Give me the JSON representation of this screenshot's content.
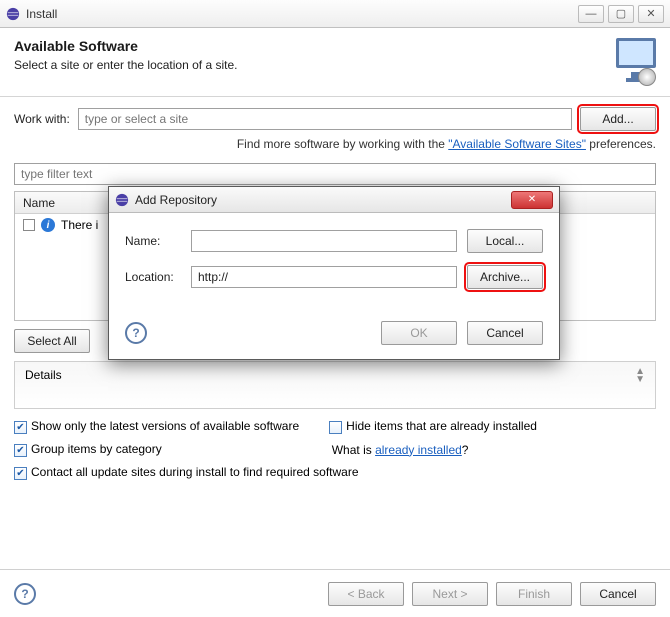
{
  "window": {
    "title": "Install"
  },
  "header": {
    "title": "Available Software",
    "subtitle": "Select a site or enter the location of a site."
  },
  "workWith": {
    "label": "Work with:",
    "placeholder": "type or select a site",
    "addButton": "Add..."
  },
  "hint": {
    "prefix": "Find more software by working with the ",
    "linkText": "\"Available Software Sites\"",
    "suffix": " preferences."
  },
  "filter": {
    "placeholder": "type filter text"
  },
  "table": {
    "colName": "Name",
    "emptyRowText": "There i"
  },
  "buttons": {
    "selectAll": "Select All",
    "back": "< Back",
    "next": "Next >",
    "finish": "Finish",
    "cancel": "Cancel"
  },
  "details": {
    "label": "Details"
  },
  "options": {
    "showLatest": "Show only the latest versions of available software",
    "hideInstalled": "Hide items that are already installed",
    "groupByCategory": "Group items by category",
    "whatIsPrefix": "What is ",
    "whatIsLink": "already installed",
    "whatIsSuffix": "?",
    "contactAll": "Contact all update sites during install to find required software"
  },
  "modal": {
    "title": "Add Repository",
    "nameLabel": "Name:",
    "nameValue": "",
    "locationLabel": "Location:",
    "locationValue": "http://",
    "localButton": "Local...",
    "archiveButton": "Archive...",
    "ok": "OK",
    "cancel": "Cancel"
  }
}
